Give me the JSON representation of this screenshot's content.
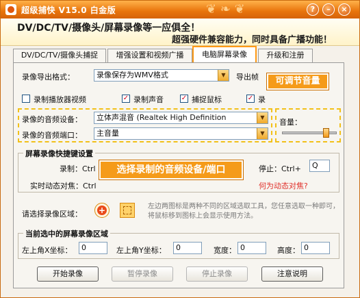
{
  "window": {
    "title": "超级捕快 V15.0 白金版",
    "controls": {
      "help": "?",
      "minimize": "–",
      "close": "×"
    }
  },
  "banner": {
    "line1": "DV/DC/TV/摄像头/屏幕录像等一应俱全！",
    "line2": "超强硬件兼容能力，同时具备广播功能！"
  },
  "tabs": [
    {
      "label": "DV/DC/TV/摄像头捕捉",
      "active": false
    },
    {
      "label": "增强设置和视频广播",
      "active": false
    },
    {
      "label": "电脑屏幕录像",
      "active": true
    },
    {
      "label": "升级和注册",
      "active": false
    }
  ],
  "record_format": {
    "label": "录像导出格式：",
    "value": "录像保存为WMV格式",
    "export_label": "导出帧"
  },
  "checkboxes": [
    {
      "label": "录制播放器视频",
      "checked": false
    },
    {
      "label": "录制声音",
      "checked": true
    },
    {
      "label": "捕捉鼠标",
      "checked": true
    },
    {
      "label": "录",
      "checked": true
    }
  ],
  "audio": {
    "device_label": "录像的音频设备：",
    "device_value": "立体声混音 (Realtek High Definition",
    "port_label": "录像的音频端口：",
    "port_value": "主音量",
    "volume_label": "音量：",
    "volume_level": 0.85
  },
  "callouts": {
    "volume": "可调节音量",
    "audio": "选择录制的音频设备/端口"
  },
  "hotkeys": {
    "title": "屏幕录像快捷键设置",
    "record_label": "录制：Ctrl",
    "object_label": "实时动态对焦：Ctrl",
    "stop_label": "停止：Ctrl+",
    "stop_value": "Q",
    "what_is_link": "何为动态对焦?"
  },
  "region": {
    "select_label": "请选择录像区域：",
    "hint": "左边两图标是两种不同的区域选取工具，您任意选取一种即可，将鼠标移到图标上会显示使用方法。"
  },
  "current_region": {
    "title": "当前选中的屏幕录像区域",
    "x_label": "左上角X坐标：",
    "x_value": "0",
    "y_label": "左上角Y坐标：",
    "y_value": "0",
    "w_label": "宽度：",
    "w_value": "0",
    "h_label": "高度：",
    "h_value": "0"
  },
  "buttons": {
    "start": "开始录像",
    "pause": "暂停录像",
    "stop": "停止录像",
    "notes": "注意说明"
  },
  "colors": {
    "title_orange": "#e8740c",
    "tab_active_border": "#ff9a16",
    "callout_bg": "#f59b1a",
    "highlight_dash": "#f2c018",
    "link_red": "#e0302a"
  }
}
